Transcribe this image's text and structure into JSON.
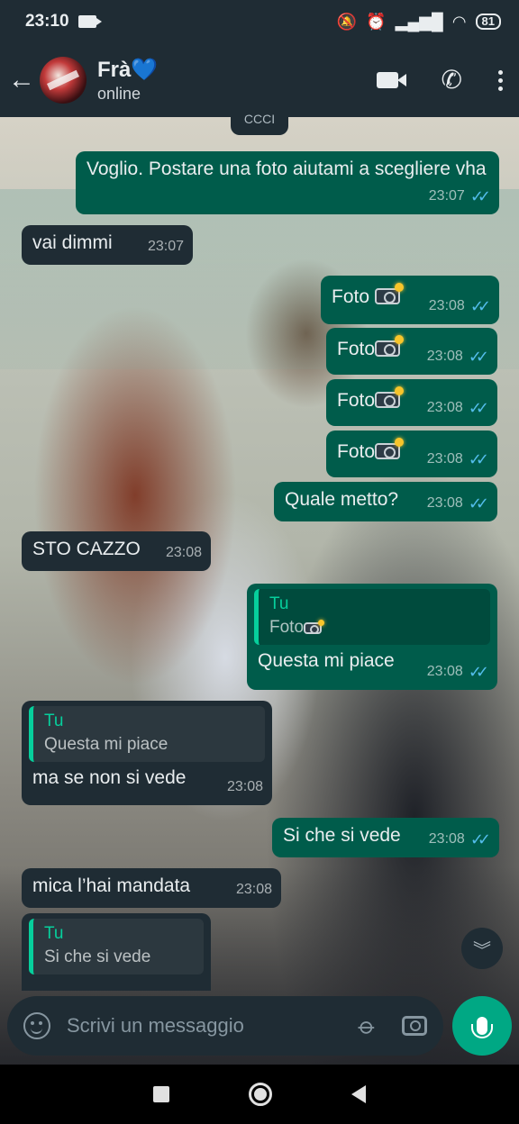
{
  "status_bar": {
    "time": "23:10",
    "battery": "81"
  },
  "header": {
    "contact_name": "Frà💙",
    "contact_status": "online"
  },
  "clipped_message": "CCCI",
  "messages": [
    {
      "text": "Voglio. Postare una foto aiutami a sceglierе vha",
      "time": "23:07",
      "direction": "out"
    },
    {
      "text": "vai dimmi",
      "time": "23:07",
      "direction": "in"
    },
    {
      "text": "Foto ",
      "time": "23:08",
      "direction": "out",
      "attachment_icon": "camera-flash-icon"
    },
    {
      "text": "Foto",
      "time": "23:08",
      "direction": "out",
      "attachment_icon": "camera-flash-icon"
    },
    {
      "text": "Foto",
      "time": "23:08",
      "direction": "out",
      "attachment_icon": "camera-flash-icon"
    },
    {
      "text": "Foto",
      "time": "23:08",
      "direction": "out",
      "attachment_icon": "camera-flash-icon"
    },
    {
      "text": "Quale metto?",
      "time": "23:08",
      "direction": "out"
    },
    {
      "text": "STO CAZZO",
      "time": "23:08",
      "direction": "in"
    },
    {
      "quote_author": "Tu",
      "quote_text": "Foto",
      "text": "Questa mi piace",
      "time": "23:08",
      "direction": "out"
    },
    {
      "quote_author": "Tu",
      "quote_text": "Questa mi piace",
      "text": "ma se non si vede",
      "time": "23:08",
      "direction": "in"
    },
    {
      "text": "Si che si vede",
      "time": "23:08",
      "direction": "out"
    },
    {
      "text": "mica l’hai mandata",
      "time": "23:08",
      "direction": "in"
    },
    {
      "quote_author": "Tu",
      "quote_text": "Si che si vede",
      "direction": "in"
    }
  ],
  "composer": {
    "placeholder": "Scrivi un messaggio"
  },
  "colors": {
    "header_bg": "#1f2c34",
    "incoming_bubble": "#1f2c34",
    "outgoing_bubble": "#005c4b",
    "accent": "#00a884",
    "read_ticks": "#53bdeb"
  }
}
